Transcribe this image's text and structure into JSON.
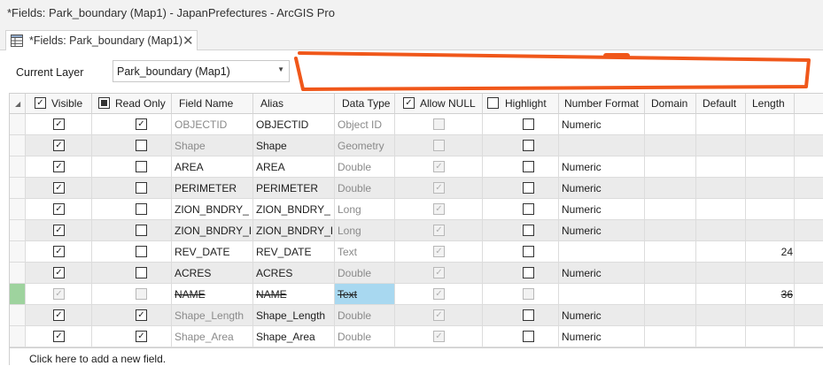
{
  "window": {
    "title": "*Fields:  Park_boundary (Map1) - JapanPrefectures - ArcGIS Pro"
  },
  "tab": {
    "label": "*Fields:  Park_boundary (Map1)",
    "close_glyph": "✕"
  },
  "toolbar": {
    "current_layer_label": "Current Layer",
    "current_layer_value": "Park_boundary (Map1)"
  },
  "colors": {
    "annotation": "#f0571a",
    "selected_cell": "#a8d8f0",
    "edit_marker": "#9ed39e"
  },
  "columns": {
    "visible": "Visible",
    "read_only": "Read Only",
    "field_name": "Field Name",
    "alias": "Alias",
    "data_type": "Data Type",
    "allow_null": "Allow NULL",
    "highlight": "Highlight",
    "number_format": "Number Format",
    "domain": "Domain",
    "default": "Default",
    "length": "Length"
  },
  "header_checkboxes": {
    "visible": true,
    "read_only": "partial",
    "allow_null": true,
    "highlight": false
  },
  "rows": [
    {
      "visible": true,
      "read_only": true,
      "field_name": "OBJECTID",
      "alias": "OBJECTID",
      "data_type": "Object ID",
      "allow_null": false,
      "highlight": false,
      "number_format": "Numeric",
      "domain": "",
      "default": "",
      "length": "",
      "shade": false,
      "edited": false,
      "struck": false
    },
    {
      "visible": true,
      "read_only": false,
      "field_name": "Shape",
      "alias": "Shape",
      "data_type": "Geometry",
      "allow_null": false,
      "highlight": false,
      "number_format": "",
      "domain": "",
      "default": "",
      "length": "",
      "shade": true,
      "edited": false,
      "struck": false
    },
    {
      "visible": true,
      "read_only": false,
      "field_name": "AREA",
      "alias": "AREA",
      "data_type": "Double",
      "allow_null": true,
      "highlight": false,
      "number_format": "Numeric",
      "domain": "",
      "default": "",
      "length": "",
      "shade": false,
      "edited": false,
      "struck": false
    },
    {
      "visible": true,
      "read_only": false,
      "field_name": "PERIMETER",
      "alias": "PERIMETER",
      "data_type": "Double",
      "allow_null": true,
      "highlight": false,
      "number_format": "Numeric",
      "domain": "",
      "default": "",
      "length": "",
      "shade": true,
      "edited": false,
      "struck": false
    },
    {
      "visible": true,
      "read_only": false,
      "field_name": "ZION_BNDRY_",
      "alias": "ZION_BNDRY_",
      "data_type": "Long",
      "allow_null": true,
      "highlight": false,
      "number_format": "Numeric",
      "domain": "",
      "default": "",
      "length": "",
      "shade": false,
      "edited": false,
      "struck": false
    },
    {
      "visible": true,
      "read_only": false,
      "field_name": "ZION_BNDRY_ID",
      "alias": "ZION_BNDRY_ID",
      "data_type": "Long",
      "allow_null": true,
      "highlight": false,
      "number_format": "Numeric",
      "domain": "",
      "default": "",
      "length": "",
      "shade": true,
      "edited": false,
      "struck": false
    },
    {
      "visible": true,
      "read_only": false,
      "field_name": "REV_DATE",
      "alias": "REV_DATE",
      "data_type": "Text",
      "allow_null": true,
      "highlight": false,
      "number_format": "",
      "domain": "",
      "default": "",
      "length": "24",
      "shade": false,
      "edited": false,
      "struck": false
    },
    {
      "visible": true,
      "read_only": false,
      "field_name": "ACRES",
      "alias": "ACRES",
      "data_type": "Double",
      "allow_null": true,
      "highlight": false,
      "number_format": "Numeric",
      "domain": "",
      "default": "",
      "length": "",
      "shade": true,
      "edited": false,
      "struck": false
    },
    {
      "visible": true,
      "read_only": false,
      "field_name": "NAME",
      "alias": "NAME",
      "data_type": "Text",
      "allow_null": true,
      "highlight": false,
      "number_format": "",
      "domain": "",
      "default": "",
      "length": "36",
      "shade": false,
      "edited": true,
      "struck": true
    },
    {
      "visible": true,
      "read_only": true,
      "field_name": "Shape_Length",
      "alias": "Shape_Length",
      "data_type": "Double",
      "allow_null": true,
      "highlight": false,
      "number_format": "Numeric",
      "domain": "",
      "default": "",
      "length": "",
      "shade": true,
      "edited": false,
      "struck": false
    },
    {
      "visible": true,
      "read_only": true,
      "field_name": "Shape_Area",
      "alias": "Shape_Area",
      "data_type": "Double",
      "allow_null": true,
      "highlight": false,
      "number_format": "Numeric",
      "domain": "",
      "default": "",
      "length": "",
      "shade": false,
      "edited": false,
      "struck": false
    }
  ],
  "add_row_text": "Click here to add a new field."
}
